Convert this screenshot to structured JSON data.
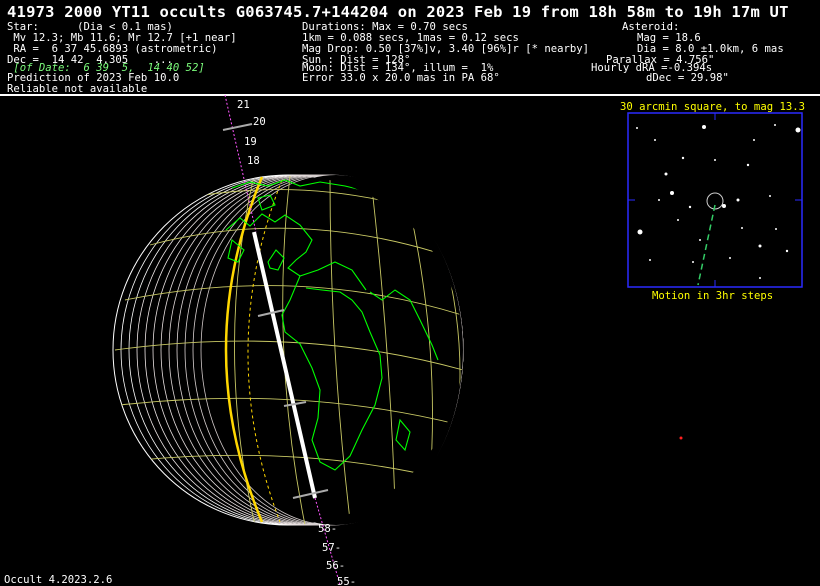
{
  "header": {
    "title": "41973 2000 YT11 occults G063745.7+144204 on 2023 Feb 19 from 18h 58m to 19h 17m UT",
    "star": {
      "heading": "Star:      (Dia < 0.1 mas)",
      "mags": " Mv 12.3; Mb 11.6; Mr 12.7 [+1 near]",
      "ra": " RA =  6 37 45.6893 (astrometric)",
      "dec": "Dec =  14 42  4.305    ...",
      "of_date": " [of Date:  6 39  5,  14 40 52]",
      "prediction": "Prediction of 2023 Feb 10.0",
      "reliable": "Reliable not available"
    },
    "durations": {
      "max": "Durations: Max = 0.70 secs",
      "km": "1km = 0.088 secs, 1mas = 0.12 secs",
      "mag_drop": "Mag Drop: 0.50 [37%]v, 3.40 [96%]r [* nearby]",
      "sun": "Sun : Dist = 128°",
      "moon": "Moon: Dist = 134°, illum =  1%",
      "error": "Error 33.0 x 20.0 mas in PA 68°"
    },
    "asteroid": {
      "heading": "Asteroid:",
      "mag": "Mag = 18.6",
      "dia": "Dia = 8.0 ±1.0km, 6 mas",
      "parallax": "Parallax = 4.756\"",
      "hourly_dra": "Hourly dRA =-0.394s",
      "ddec": "dDec = 29.98\""
    }
  },
  "inset": {
    "title": "30 arcmin square, to mag 13.3",
    "caption": "Motion in 3hr steps"
  },
  "path_ticks": {
    "top": [
      "21",
      "20",
      "19",
      "18"
    ],
    "bottom": [
      "58-",
      "57-",
      "56-",
      "55-"
    ]
  },
  "footer": "Occult 4.2023.2.6",
  "colors": {
    "background": "#000000",
    "text": "#ffffff",
    "grid": "#c8c864",
    "coastline": "#00ff00",
    "terminator": "#ffd700",
    "inset_frame": "#2a2aff",
    "inset_text": "#ffff00",
    "of_date": "#7cfc7c"
  }
}
